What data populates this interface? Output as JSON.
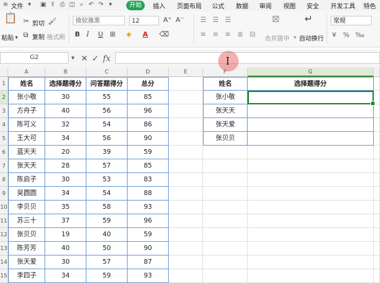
{
  "menu": {
    "file": "文件",
    "items": [
      "开始",
      "插入",
      "页面布局",
      "公式",
      "数据",
      "审阅",
      "视图",
      "安全",
      "开发工具",
      "特色"
    ]
  },
  "ribbon": {
    "cut": "剪切",
    "paste": "粘贴",
    "copy": "复制",
    "format_painter": "格式刷",
    "font_name": "微软雅黑",
    "font_size": "12",
    "bold": "B",
    "italic": "I",
    "underline": "U",
    "merge_center": "合并居中",
    "wrap_text": "自动换行",
    "number_format": "常规"
  },
  "formula_bar": {
    "cell_ref": "G2",
    "cancel_icon": "✕",
    "enter_icon": "✓",
    "fx_label": "fx",
    "formula": ""
  },
  "sheet": {
    "columns": [
      "A",
      "B",
      "C",
      "D",
      "E",
      "F",
      "G"
    ],
    "row_numbers": [
      "1",
      "2",
      "3",
      "4",
      "5",
      "6",
      "7",
      "8",
      "9",
      "10",
      "11",
      "12",
      "13",
      "14",
      "15"
    ],
    "table_headers": [
      "姓名",
      "选择题得分",
      "问答题得分",
      "总分"
    ],
    "rows": [
      [
        "张小敬",
        "30",
        "55",
        "85"
      ],
      [
        "方舟子",
        "40",
        "56",
        "96"
      ],
      [
        "陈可义",
        "32",
        "54",
        "86"
      ],
      [
        "王大可",
        "34",
        "56",
        "90"
      ],
      [
        "蓝天天",
        "20",
        "39",
        "59"
      ],
      [
        "张天天",
        "28",
        "57",
        "85"
      ],
      [
        "陈启子",
        "30",
        "53",
        "83"
      ],
      [
        "吴圆圆",
        "34",
        "54",
        "88"
      ],
      [
        "李贝贝",
        "35",
        "58",
        "93"
      ],
      [
        "苏三十",
        "37",
        "59",
        "96"
      ],
      [
        "张贝贝",
        "19",
        "40",
        "59"
      ],
      [
        "陈芳芳",
        "40",
        "50",
        "90"
      ],
      [
        "张天爱",
        "30",
        "57",
        "87"
      ],
      [
        "李四子",
        "34",
        "59",
        "93"
      ]
    ],
    "lookup_headers": [
      "姓名",
      "选择题得分"
    ],
    "lookup_names": [
      "张小敬",
      "张天天",
      "张天爱",
      "张贝贝"
    ]
  },
  "colors": {
    "start_tab": "#23a35a",
    "selection": "#1f8a3a",
    "table_border": "#6f9fd8"
  }
}
